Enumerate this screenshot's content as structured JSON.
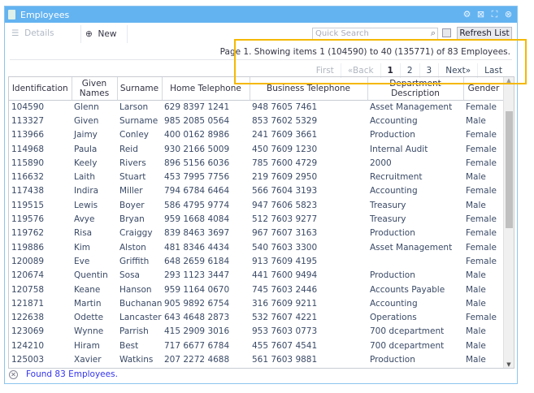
{
  "window": {
    "title": "Employees"
  },
  "toolbar": {
    "details_label": "Details",
    "new_label": "New",
    "search_placeholder": "Quick Search",
    "refresh_label": "Refresh List"
  },
  "pagination": {
    "info": "Page 1. Showing items 1 (104590) to 40 (135771) of 83 Employees.",
    "first": "First",
    "back": "«Back",
    "pages": [
      "1",
      "2",
      "3"
    ],
    "current_page": "1",
    "next": "Next»",
    "last": "Last"
  },
  "table": {
    "columns": [
      "Identification",
      "Given Names",
      "Surname",
      "Home Telephone",
      "Business Telephone",
      "Department Description",
      "Gender"
    ],
    "rows": [
      [
        "104590",
        "Glenn",
        "Larson",
        "629 8397 1241",
        "948 7605 7461",
        "Asset Management",
        "Female"
      ],
      [
        "113327",
        "Given",
        "Surname",
        "985 2085 0564",
        "853 7602 5329",
        "Accounting",
        "Male"
      ],
      [
        "113966",
        "Jaimy",
        "Conley",
        "400 0162 8986",
        "241 7609 3661",
        "Production",
        "Female"
      ],
      [
        "114968",
        "Paula",
        "Reid",
        "930 2166 5009",
        "450 7609 1230",
        "Internal Audit",
        "Female"
      ],
      [
        "115890",
        "Keely",
        "Rivers",
        "896 5156 6036",
        "785 7600 4729",
        "2000",
        "Female"
      ],
      [
        "116632",
        "Laith",
        "Stuart",
        "453 7995 7756",
        "219 7609 2950",
        "Recruitment",
        "Male"
      ],
      [
        "117438",
        "Indira",
        "Miller",
        "794 6784 6464",
        "566 7604 3193",
        "Accounting",
        "Female"
      ],
      [
        "119515",
        "Lewis",
        "Boyer",
        "586 4795 9774",
        "947 7606 5823",
        "Treasury",
        "Male"
      ],
      [
        "119576",
        "Avye",
        "Bryan",
        "959 1668 4084",
        "512 7603 9277",
        "Treasury",
        "Female"
      ],
      [
        "119762",
        "Risa",
        "Craiggy",
        "839 8463 3697",
        "967 7607 3163",
        "Production",
        "Female"
      ],
      [
        "119886",
        "Kim",
        "Alston",
        "481 8346 4434",
        "540 7603 3300",
        "Asset Management",
        "Female"
      ],
      [
        "120089",
        "Eve",
        "Griffith",
        "648 2659 6184",
        "913 7609 4195",
        "",
        "Female"
      ],
      [
        "120674",
        "Quentin",
        "Sosa",
        "293 1123 3447",
        "441 7600 9494",
        "Production",
        "Male"
      ],
      [
        "120758",
        "Keane",
        "Hanson",
        "959 1164 0670",
        "745 7603 2446",
        "Accounts Payable",
        "Male"
      ],
      [
        "121871",
        "Martin",
        "Buchanan",
        "905 9892 6754",
        "316 7609 9211",
        "Accounting",
        "Male"
      ],
      [
        "122638",
        "Odette",
        "Lancaster",
        "643 4648 2873",
        "532 7607 4221",
        "Operations",
        "Female"
      ],
      [
        "123069",
        "Wynne",
        "Parrish",
        "415 2909 3016",
        "953 7603 0773",
        "700 dcepartment",
        "Male"
      ],
      [
        "124210",
        "Hiram",
        "Best",
        "717 6677 6784",
        "455 7607 4541",
        "700 dcepartment",
        "Male"
      ],
      [
        "125003",
        "Xavier",
        "Watkins",
        "207 2272 4688",
        "561 7603 9881",
        "Production",
        "Male"
      ]
    ]
  },
  "status": {
    "text": "Found 83 Employees."
  },
  "colors": {
    "titlebar": "#63b3f1",
    "highlight": "#f5b800",
    "status_text": "#3333ee"
  }
}
